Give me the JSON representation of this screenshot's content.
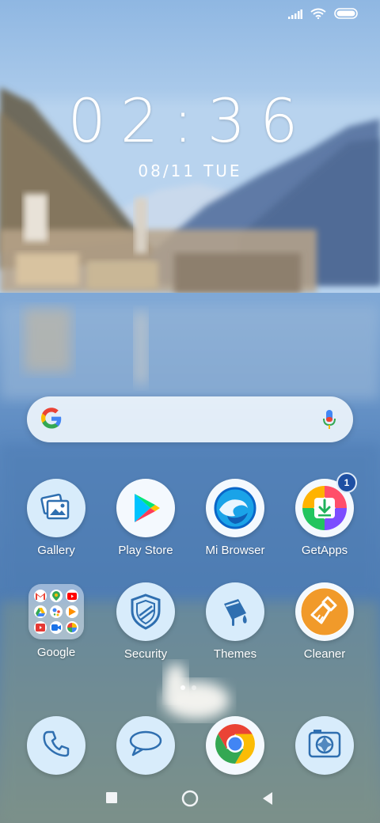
{
  "wallpaper": {
    "description_icon": "lake-landscape-wallpaper"
  },
  "status_bar": {
    "icons": [
      "signal-icon",
      "wifi-icon",
      "battery-icon"
    ]
  },
  "lockscreen_clock": {
    "time": "02:36",
    "date": "08/11",
    "weekday": "TUE"
  },
  "search_bar": {
    "logo": "google-g-icon",
    "mic": "microphone-icon"
  },
  "apps_row1": [
    {
      "label": "Gallery",
      "icon": "gallery-icon"
    },
    {
      "label": "Play Store",
      "icon": "play-store-icon"
    },
    {
      "label": "Mi Browser",
      "icon": "mi-browser-icon"
    },
    {
      "label": "GetApps",
      "icon": "getapps-icon",
      "badge": "1"
    }
  ],
  "apps_row2": [
    {
      "label": "Google",
      "icon": "google-folder-icon"
    },
    {
      "label": "Security",
      "icon": "security-shield-icon"
    },
    {
      "label": "Themes",
      "icon": "themes-paint-icon"
    },
    {
      "label": "Cleaner",
      "icon": "cleaner-broom-icon"
    }
  ],
  "dock": [
    {
      "icon": "phone-icon"
    },
    {
      "icon": "messaging-icon"
    },
    {
      "icon": "chrome-icon"
    },
    {
      "icon": "camera-icon"
    }
  ],
  "nav": [
    "recent-apps-square-icon",
    "home-circle-icon",
    "back-triangle-icon"
  ],
  "colors": {
    "icon_bg": "#d8ecfb",
    "badge": "#1e4fa3",
    "accent_orange": "#f19a2a"
  }
}
